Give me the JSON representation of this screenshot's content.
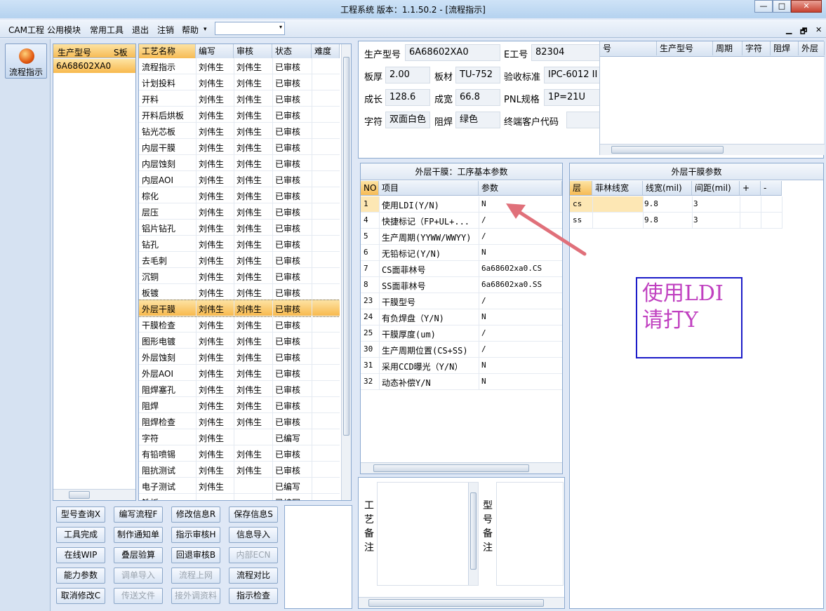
{
  "window": {
    "title": "工程系统   版本：1.1.50.2 - [流程指示]",
    "min": "—",
    "max": "□",
    "close": "✕"
  },
  "menu": {
    "items": [
      "CAM工程",
      "公用模块",
      "常用工具",
      "退出",
      "注销",
      "帮助"
    ],
    "help_arrow": "▾",
    "combo_arrow": "▾",
    "mdi": [
      "▁",
      "🗗",
      "✕"
    ]
  },
  "sidebar": {
    "button_label": "流程指示"
  },
  "models": {
    "headers": [
      "生产型号",
      "S板"
    ],
    "rows": [
      [
        "6A68602XA0",
        ""
      ]
    ]
  },
  "process": {
    "headers": [
      "工艺名称",
      "编写",
      "审核",
      "状态",
      "难度"
    ],
    "rows": [
      [
        "流程指示",
        "刘伟生",
        "刘伟生",
        "已审核"
      ],
      [
        "计划投料",
        "刘伟生",
        "刘伟生",
        "已审核"
      ],
      [
        "开料",
        "刘伟生",
        "刘伟生",
        "已审核"
      ],
      [
        "开料后烘板",
        "刘伟生",
        "刘伟生",
        "已审核"
      ],
      [
        "钻光芯板",
        "刘伟生",
        "刘伟生",
        "已审核"
      ],
      [
        "内层干膜",
        "刘伟生",
        "刘伟生",
        "已审核"
      ],
      [
        "内层蚀刻",
        "刘伟生",
        "刘伟生",
        "已审核"
      ],
      [
        "内层AOI",
        "刘伟生",
        "刘伟生",
        "已审核"
      ],
      [
        "棕化",
        "刘伟生",
        "刘伟生",
        "已审核"
      ],
      [
        "层压",
        "刘伟生",
        "刘伟生",
        "已审核"
      ],
      [
        "铝片钻孔",
        "刘伟生",
        "刘伟生",
        "已审核"
      ],
      [
        "钻孔",
        "刘伟生",
        "刘伟生",
        "已审核"
      ],
      [
        "去毛刺",
        "刘伟生",
        "刘伟生",
        "已审核"
      ],
      [
        "沉铜",
        "刘伟生",
        "刘伟生",
        "已审核"
      ],
      [
        "板镀",
        "刘伟生",
        "刘伟生",
        "已审核"
      ],
      [
        "外层干膜",
        "刘伟生",
        "刘伟生",
        "已审核"
      ],
      [
        "干膜检查",
        "刘伟生",
        "刘伟生",
        "已审核"
      ],
      [
        "图形电镀",
        "刘伟生",
        "刘伟生",
        "已审核"
      ],
      [
        "外层蚀刻",
        "刘伟生",
        "刘伟生",
        "已审核"
      ],
      [
        "外层AOI",
        "刘伟生",
        "刘伟生",
        "已审核"
      ],
      [
        "阻焊塞孔",
        "刘伟生",
        "刘伟生",
        "已审核"
      ],
      [
        "阻焊",
        "刘伟生",
        "刘伟生",
        "已审核"
      ],
      [
        "阻焊检查",
        "刘伟生",
        "刘伟生",
        "已审核"
      ],
      [
        "字符",
        "刘伟生",
        "",
        "已编写"
      ],
      [
        "有铅喷锡",
        "刘伟生",
        "刘伟生",
        "已审核"
      ],
      [
        "阻抗测试",
        "刘伟生",
        "刘伟生",
        "已审核"
      ],
      [
        "电子测试",
        "刘伟生",
        "",
        "已编写"
      ],
      [
        "铣板",
        "",
        "",
        "已编写"
      ]
    ],
    "selected_index": 15
  },
  "buttons": [
    [
      "型号查询X",
      "编写流程F",
      "修改信息R",
      "保存信息S"
    ],
    [
      "工具完成",
      "制作通知单",
      "指示审核H",
      "信息导入"
    ],
    [
      "在线WIP",
      "叠层验算",
      "回退审核B",
      "内部ECN"
    ],
    [
      "能力参数",
      "调单导入",
      "流程上网",
      "流程对比"
    ],
    [
      "取消修改C",
      "传送文件",
      "接外调资料",
      "指示检查"
    ]
  ],
  "disabled_buttons": [
    "内部ECN",
    "调单导入",
    "流程上网",
    "传送文件",
    "接外调资料"
  ],
  "info": {
    "labels": {
      "model": "生产型号",
      "eng": "E工号",
      "thick": "板厚",
      "mat": "板材",
      "std": "验收标准",
      "len": "成长",
      "wid": "成宽",
      "pnl": "PNL规格",
      "char": "字符",
      "mask": "阻焊",
      "cust": "终端客户代码"
    },
    "values": {
      "model": "6A68602XA0",
      "eng": "82304",
      "thick": "2.00",
      "mat": "TU-752",
      "std": "IPC-6012 II",
      "len": "128.6",
      "wid": "66.8",
      "pnl": "1P=21U",
      "char": "双面白色",
      "mask": "绿色",
      "cust": ""
    }
  },
  "right_grid": {
    "headers": [
      "号",
      "生产型号",
      "周期",
      "字符",
      "阻焊",
      "外层"
    ]
  },
  "params": {
    "title": "外层干膜：工序基本参数",
    "headers": [
      "NO",
      "项目",
      "参数"
    ],
    "rows": [
      [
        "1",
        "使用LDI(Y/N)",
        "N"
      ],
      [
        "4",
        "快捷标记（FP+UL+...",
        "/"
      ],
      [
        "5",
        "生产周期(YYWW/WWYY)",
        "/"
      ],
      [
        "6",
        "无铅标记(Y/N)",
        "N"
      ],
      [
        "7",
        "CS面菲林号",
        "6a68602xa0.CS"
      ],
      [
        "8",
        "SS面菲林号",
        "6a68602xa0.SS"
      ],
      [
        "23",
        "干膜型号",
        "/"
      ],
      [
        "24",
        "有负焊盘（Y/N)",
        "N"
      ],
      [
        "25",
        "干膜厚度(um)",
        "/"
      ],
      [
        "30",
        "生产周期位置(CS+SS)",
        "/"
      ],
      [
        "31",
        "采用CCD曝光（Y/N）",
        "N"
      ],
      [
        "32",
        "动态补偿Y/N",
        "N"
      ]
    ]
  },
  "film": {
    "title": "外层干膜参数",
    "headers": [
      "层",
      "菲林线宽",
      "线宽(mil)",
      "间距(mil)",
      "+",
      "-"
    ],
    "rows": [
      [
        "cs",
        "",
        "9.8",
        "3"
      ],
      [
        "ss",
        "",
        "9.8",
        "3"
      ]
    ]
  },
  "annotation": {
    "line1": "使用LDI",
    "line2": "请打Y",
    "color": "#c040c0"
  },
  "notes": {
    "process_label": "工艺备注",
    "model_label": "型号备注"
  }
}
